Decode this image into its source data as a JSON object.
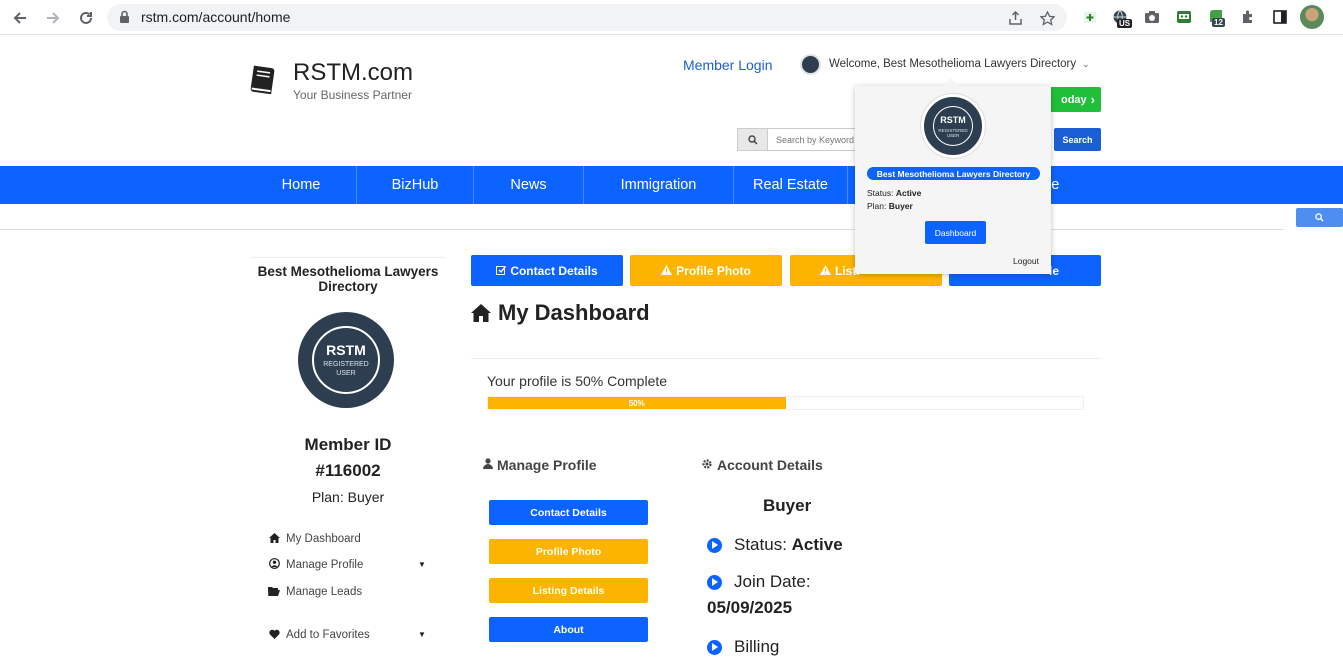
{
  "browser": {
    "url": "rstm.com/account/home",
    "ext_badge_us": "US",
    "ext_badge_count": "12"
  },
  "header": {
    "logo_title": "RSTM.com",
    "logo_subtitle": "Your Business Partner",
    "member_login": "Member Login",
    "welcome_text": "Welcome, Best Mesothelioma Lawyers Directory",
    "green_button_label": "oday",
    "search_placeholder": "Search by Keyword",
    "search_button": "Search"
  },
  "nav": {
    "items": [
      "Home",
      "BizHub",
      "News",
      "Immigration",
      "Real Estate",
      "ale"
    ]
  },
  "popup": {
    "logo_big": "RSTM",
    "logo_small": "REGISTERED USER",
    "name": "Best Mesothelioma Lawyers Directory",
    "status_label": "Status:",
    "status_value": "Active",
    "plan_label": "Plan:",
    "plan_value": "Buyer",
    "dashboard_button": "Dashboard",
    "logout": "Logout"
  },
  "sidebar": {
    "title": "Best Mesothelioma Lawyers Directory",
    "logo_big": "RSTM",
    "logo_small_1": "REGISTERED",
    "logo_small_2": "USER",
    "member_id_label": "Member ID",
    "member_id": "#116002",
    "plan": "Plan: Buyer",
    "menu": [
      {
        "label": "My Dashboard",
        "icon": "home-icon"
      },
      {
        "label": "Manage Profile",
        "icon": "user-circle-icon"
      },
      {
        "label": "Manage Leads",
        "icon": "folder-open-icon"
      },
      {
        "label": "Add to Favorites",
        "icon": "heart-icon"
      }
    ]
  },
  "main": {
    "top_buttons": [
      {
        "label": "Contact Details",
        "color": "#0d63ff"
      },
      {
        "label": "Profile Photo",
        "color": "#fdb400"
      },
      {
        "label": "Listi",
        "color": "#fdb400"
      },
      {
        "label": "le",
        "color": "#0d63ff"
      }
    ],
    "title": "My Dashboard",
    "profile_text": "Your profile is 50% Complete",
    "progress_percent": 50,
    "progress_label": "50%",
    "manage_profile_title": "Manage Profile",
    "manage_profile_buttons": [
      {
        "label": "Contact Details",
        "color": "#0d63ff"
      },
      {
        "label": "Profile Photo",
        "color": "#fdb400"
      },
      {
        "label": "Listing Details",
        "color": "#fdb400"
      },
      {
        "label": "About",
        "color": "#0d63ff"
      }
    ],
    "account_details_title": "Account Details",
    "account_plan": "Buyer",
    "status_label": "Status: ",
    "status_value": "Active",
    "join_label": "Join Date:",
    "join_date": "05/09/2025",
    "billing_label": "Billing"
  },
  "colors": {
    "primary_blue": "#0d63ff",
    "accent_yellow": "#fdb400",
    "success_green": "#1fbf3a",
    "logo_navy": "#2d3e50"
  }
}
